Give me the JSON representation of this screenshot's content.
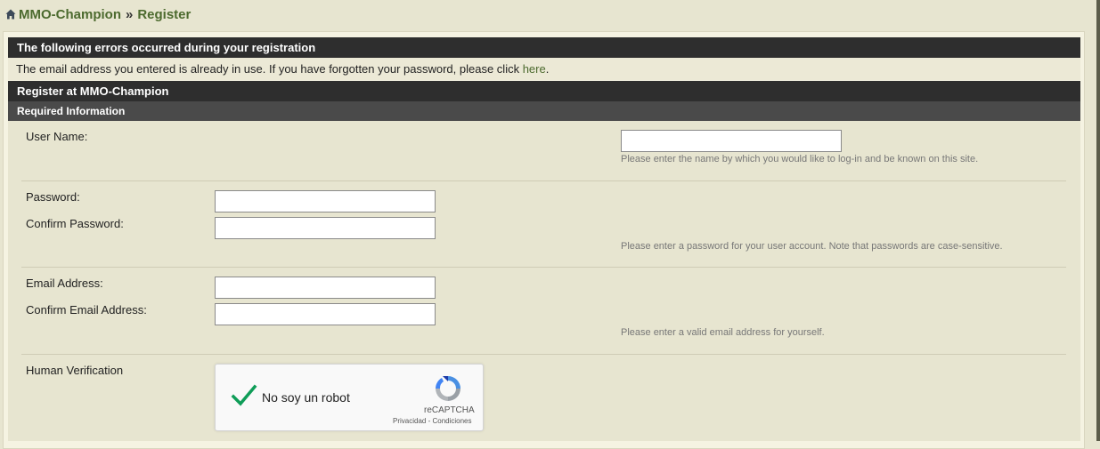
{
  "breadcrumb": {
    "home_icon": "home-icon",
    "site": "MMO-Champion",
    "separator": "»",
    "current": "Register"
  },
  "errors": {
    "title": "The following errors occurred during your registration",
    "message": "The email address you entered is already in use. If you have forgotten your password, please click ",
    "link_text": "here",
    "message_end": "."
  },
  "register": {
    "title": "Register at MMO-Champion",
    "section": "Required Information"
  },
  "fields": {
    "username_label": "User Name:",
    "username_value": "",
    "username_hint": "Please enter the name by which you would like to log-in and be known on this site.",
    "password_label": "Password:",
    "confirm_password_label": "Confirm Password:",
    "password_hint": "Please enter a password for your user account. Note that passwords are case-sensitive.",
    "email_label": "Email Address:",
    "confirm_email_label": "Confirm Email Address:",
    "email_hint": "Please enter a valid email address for yourself.",
    "verification_label": "Human Verification"
  },
  "captcha": {
    "label": "No soy un robot",
    "brand": "reCAPTCHA",
    "privacy": "Privacidad",
    "dash": " - ",
    "terms": "Condiciones",
    "checked": true,
    "check_color": "#0f9d58"
  },
  "colors": {
    "accent": "#4c6a2e",
    "header_bar": "#2e2e2e",
    "background": "#e7e5d0"
  }
}
